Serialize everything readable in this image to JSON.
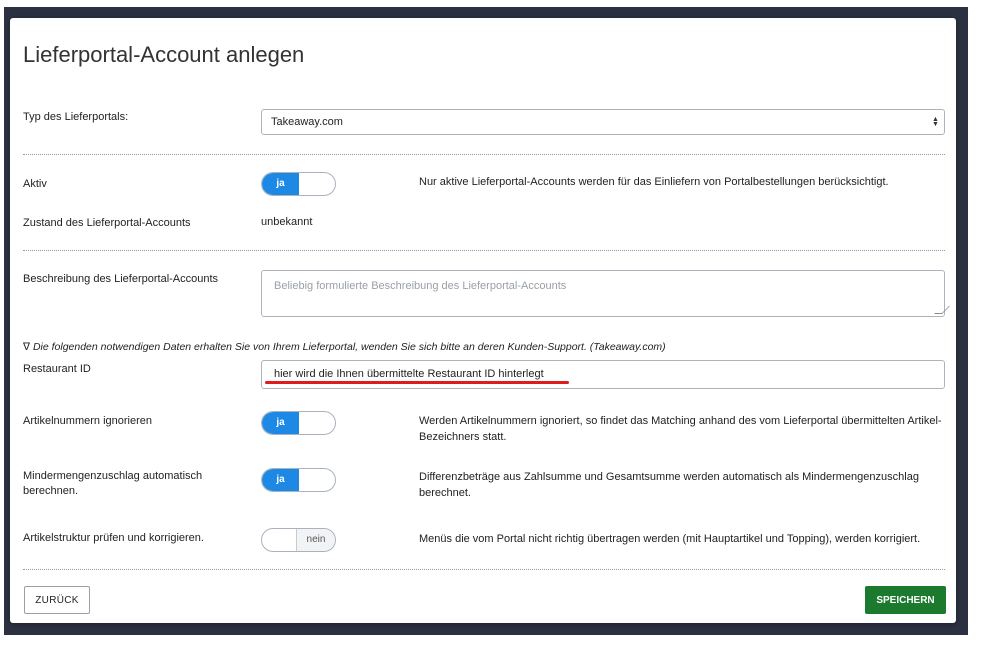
{
  "dialog": {
    "title": "Lieferportal-Account anlegen"
  },
  "fields": {
    "portal_type": {
      "label": "Typ des Lieferportals:",
      "value": "Takeaway.com"
    },
    "active": {
      "label": "Aktiv",
      "toggle_on": "ja",
      "hint": "Nur aktive Lieferportal-Accounts werden für das Einliefern von Portalbestellungen berücksichtigt."
    },
    "state": {
      "label": "Zustand des Lieferportal-Accounts",
      "value": "unbekannt"
    },
    "description": {
      "label": "Beschreibung des Lieferportal-Accounts",
      "placeholder": "Beliebig formulierte Beschreibung des Lieferportal-Accounts"
    },
    "note": "∇ Die folgenden notwendigen Daten erhalten Sie von Ihrem Lieferportal, wenden Sie sich bitte an deren Kunden-Support. (Takeaway.com)",
    "restaurant_id": {
      "label": "Restaurant ID",
      "value": "hier wird die Ihnen übermittelte Restaurant ID hinterlegt"
    },
    "ignore_article_numbers": {
      "label": "Artikelnummern ignorieren",
      "toggle_on": "ja",
      "hint": "Werden Artikelnummern ignoriert, so findet das Matching anhand des vom Lieferportal übermittelten Artikel-Bezeichners statt."
    },
    "min_surcharge": {
      "label_line1": "Mindermengenzuschlag automatisch",
      "label_line2": "berechnen.",
      "toggle_on": "ja",
      "hint": "Differenzbeträge aus Zahlsumme und Gesamtsumme werden automatisch als Mindermengenzuschlag berechnet."
    },
    "check_structure": {
      "label": "Artikelstruktur prüfen und korrigieren.",
      "toggle_off": "nein",
      "hint": "Menüs die vom Portal nicht richtig übertragen werden (mit Hauptartikel und Topping), werden korrigiert."
    }
  },
  "buttons": {
    "back": "ZURÜCK",
    "save": "SPEICHERN"
  },
  "colors": {
    "toggle_on": "#1e88e5",
    "save_button": "#1b7a2e",
    "annotation_line": "#e01b1b"
  }
}
